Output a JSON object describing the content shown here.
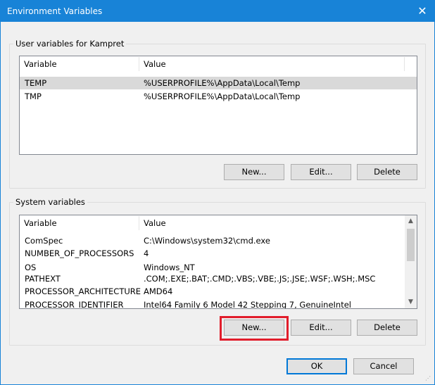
{
  "window": {
    "title": "Environment Variables",
    "close_glyph": "✕"
  },
  "user_vars": {
    "group_label": "User variables for Kampret",
    "columns": [
      "Variable",
      "Value"
    ],
    "rows": [
      {
        "variable": "TEMP",
        "value": "%USERPROFILE%\\AppData\\Local\\Temp"
      },
      {
        "variable": "TMP",
        "value": "%USERPROFILE%\\AppData\\Local\\Temp"
      }
    ],
    "buttons": {
      "new": "New...",
      "edit": "Edit...",
      "delete": "Delete"
    }
  },
  "system_vars": {
    "group_label": "System variables",
    "columns": [
      "Variable",
      "Value"
    ],
    "rows": [
      {
        "variable": "ComSpec",
        "value": "C:\\Windows\\system32\\cmd.exe"
      },
      {
        "variable": "NUMBER_OF_PROCESSORS",
        "value": "4"
      },
      {
        "variable": "OS",
        "value": "Windows_NT"
      },
      {
        "variable": "PATHEXT",
        "value": ".COM;.EXE;.BAT;.CMD;.VBS;.VBE;.JS;.JSE;.WSF;.WSH;.MSC"
      },
      {
        "variable": "PROCESSOR_ARCHITECTURE",
        "value": "AMD64"
      },
      {
        "variable": "PROCESSOR_IDENTIFIER",
        "value": "Intel64 Family 6 Model 42 Stepping 7, GenuineIntel"
      }
    ],
    "buttons": {
      "new": "New...",
      "edit": "Edit...",
      "delete": "Delete"
    }
  },
  "footer": {
    "ok": "OK",
    "cancel": "Cancel"
  },
  "icons": {
    "scroll_up": "▲",
    "scroll_down": "▼",
    "resize_grip": "⋰"
  },
  "colors": {
    "accent": "#1883d7",
    "highlight": "#e11d2b"
  }
}
